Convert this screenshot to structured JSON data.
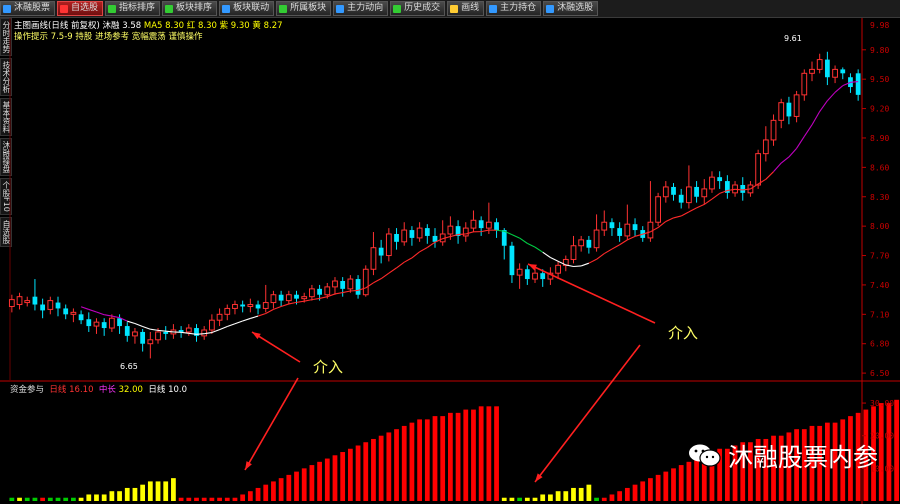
{
  "toolbar": {
    "buttons": [
      {
        "label": "沐融股票",
        "icon_color": "#39f"
      },
      {
        "label": "自选股",
        "icon_color": "#f33",
        "active": true
      },
      {
        "label": "指标排序",
        "icon_color": "#3c3"
      },
      {
        "label": "板块排序",
        "icon_color": "#3c3"
      },
      {
        "label": "板块联动",
        "icon_color": "#39f"
      },
      {
        "label": "所属板块",
        "icon_color": "#3c3"
      },
      {
        "label": "主力动向",
        "icon_color": "#39f"
      },
      {
        "label": "历史成交",
        "icon_color": "#3c3"
      },
      {
        "label": "画线",
        "icon_color": "#fc3"
      },
      {
        "label": "主力持仓",
        "icon_color": "#39f"
      },
      {
        "label": "沐融选股",
        "icon_color": "#39f"
      }
    ]
  },
  "sidebar": {
    "tabs": [
      "分时走势",
      "技术分析",
      "基本资料",
      "沐融操盘",
      "个股F10",
      "自选股"
    ]
  },
  "main_header": {
    "title": "主图画线(日线 前复权) 沐融 3.58",
    "vals": "MA5 8.30  红 8.30  紫 9.30  黄 8.27",
    "line2": "操作提示 7.5-9 持股 进场参考 宽幅震荡 谨慎操作"
  },
  "sub_header": {
    "name": "资金参与",
    "lbl1": "日线",
    "v1": "16.10",
    "lbl2": "中长",
    "v2": "32.00",
    "lbl3": "日线",
    "v3": "10.0"
  },
  "annotations": {
    "left": "介入",
    "right": "介入",
    "low_label": "6.65",
    "high_label": "9.61"
  },
  "watermark": "沐融股票内参",
  "colors": {
    "up": "#ff3232",
    "down": "#00e5ff",
    "ma_white": "#ffffff",
    "ma_red": "#ff2a2a",
    "ma_purple": "#c000c0",
    "ma_green": "#00cc44",
    "vol_red": "#ff0000",
    "vol_yellow": "#ffff00",
    "vol_green": "#00cc00",
    "arrow": "#ff2020",
    "axis": "#c00000"
  },
  "price_axis": {
    "ticks": [
      6.5,
      6.8,
      7.1,
      7.4,
      7.7,
      8.0,
      8.3,
      8.6,
      8.9,
      9.2,
      9.5,
      9.8
    ],
    "min": 6.45,
    "max": 9.9,
    "top_label": "9.98"
  },
  "vol_axis": {
    "ticks": [
      "10.00",
      "20.00",
      "30.00"
    ],
    "max": 34
  },
  "chart_data": {
    "type": "candlestick",
    "ohlc": [
      [
        7.18,
        7.25,
        7.12,
        7.3
      ],
      [
        7.2,
        7.28,
        7.15,
        7.32
      ],
      [
        7.22,
        7.24,
        7.18,
        7.28
      ],
      [
        7.28,
        7.2,
        7.14,
        7.46
      ],
      [
        7.2,
        7.14,
        7.06,
        7.26
      ],
      [
        7.15,
        7.24,
        7.1,
        7.28
      ],
      [
        7.22,
        7.16,
        7.08,
        7.28
      ],
      [
        7.16,
        7.1,
        7.05,
        7.2
      ],
      [
        7.1,
        7.12,
        7.02,
        7.16
      ],
      [
        7.1,
        7.04,
        7.0,
        7.14
      ],
      [
        7.05,
        6.98,
        6.92,
        7.12
      ],
      [
        6.98,
        7.02,
        6.9,
        7.06
      ],
      [
        7.02,
        6.96,
        6.88,
        7.06
      ],
      [
        6.96,
        7.06,
        6.92,
        7.1
      ],
      [
        7.06,
        6.98,
        6.9,
        7.1
      ],
      [
        6.98,
        6.88,
        6.82,
        7.02
      ],
      [
        6.88,
        6.92,
        6.8,
        6.96
      ],
      [
        6.92,
        6.8,
        6.72,
        6.95
      ],
      [
        6.8,
        6.84,
        6.65,
        6.92
      ],
      [
        6.84,
        6.92,
        6.8,
        6.96
      ],
      [
        6.92,
        6.9,
        6.84,
        6.98
      ],
      [
        6.9,
        6.94,
        6.85,
        7.0
      ],
      [
        6.94,
        6.92,
        6.86,
        6.98
      ],
      [
        6.92,
        6.96,
        6.88,
        7.0
      ],
      [
        6.96,
        6.88,
        6.82,
        7.0
      ],
      [
        6.88,
        6.94,
        6.84,
        6.98
      ],
      [
        6.94,
        7.04,
        6.9,
        7.1
      ],
      [
        7.04,
        7.1,
        6.98,
        7.16
      ],
      [
        7.1,
        7.16,
        7.04,
        7.2
      ],
      [
        7.16,
        7.2,
        7.1,
        7.24
      ],
      [
        7.2,
        7.18,
        7.12,
        7.24
      ],
      [
        7.18,
        7.2,
        7.12,
        7.26
      ],
      [
        7.2,
        7.16,
        7.1,
        7.24
      ],
      [
        7.16,
        7.22,
        7.12,
        7.4
      ],
      [
        7.22,
        7.3,
        7.16,
        7.34
      ],
      [
        7.3,
        7.24,
        7.18,
        7.34
      ],
      [
        7.24,
        7.3,
        7.2,
        7.34
      ],
      [
        7.3,
        7.26,
        7.2,
        7.34
      ],
      [
        7.26,
        7.28,
        7.22,
        7.32
      ],
      [
        7.28,
        7.36,
        7.24,
        7.4
      ],
      [
        7.36,
        7.3,
        7.24,
        7.4
      ],
      [
        7.3,
        7.38,
        7.26,
        7.42
      ],
      [
        7.38,
        7.44,
        7.3,
        7.48
      ],
      [
        7.44,
        7.36,
        7.28,
        7.48
      ],
      [
        7.36,
        7.46,
        7.32,
        7.5
      ],
      [
        7.46,
        7.3,
        7.26,
        7.5
      ],
      [
        7.3,
        7.56,
        7.28,
        7.6
      ],
      [
        7.56,
        7.78,
        7.5,
        7.94
      ],
      [
        7.78,
        7.7,
        7.62,
        7.86
      ],
      [
        7.7,
        7.92,
        7.64,
        7.98
      ],
      [
        7.92,
        7.84,
        7.76,
        7.98
      ],
      [
        7.84,
        7.96,
        7.8,
        8.04
      ],
      [
        7.96,
        7.88,
        7.8,
        8.0
      ],
      [
        7.88,
        7.98,
        7.84,
        8.04
      ],
      [
        7.98,
        7.9,
        7.82,
        8.02
      ],
      [
        7.9,
        7.84,
        7.78,
        7.98
      ],
      [
        7.84,
        7.92,
        7.8,
        8.06
      ],
      [
        7.92,
        8.0,
        7.86,
        8.1
      ],
      [
        8.0,
        7.9,
        7.82,
        8.06
      ],
      [
        7.9,
        7.98,
        7.84,
        8.04
      ],
      [
        7.98,
        8.06,
        7.94,
        8.16
      ],
      [
        8.06,
        7.98,
        7.9,
        8.1
      ],
      [
        7.98,
        8.04,
        7.92,
        8.24
      ],
      [
        8.04,
        7.96,
        7.88,
        8.08
      ],
      [
        7.96,
        7.8,
        7.66,
        7.98
      ],
      [
        7.8,
        7.5,
        7.42,
        7.84
      ],
      [
        7.5,
        7.56,
        7.36,
        7.62
      ],
      [
        7.56,
        7.46,
        7.4,
        7.6
      ],
      [
        7.46,
        7.52,
        7.42,
        7.6
      ],
      [
        7.52,
        7.46,
        7.38,
        7.56
      ],
      [
        7.46,
        7.52,
        7.4,
        7.58
      ],
      [
        7.52,
        7.6,
        7.46,
        7.64
      ],
      [
        7.6,
        7.66,
        7.54,
        7.7
      ],
      [
        7.66,
        7.8,
        7.62,
        7.9
      ],
      [
        7.8,
        7.86,
        7.74,
        7.9
      ],
      [
        7.86,
        7.78,
        7.72,
        7.9
      ],
      [
        7.78,
        7.96,
        7.74,
        8.12
      ],
      [
        7.96,
        8.04,
        7.9,
        8.16
      ],
      [
        8.04,
        7.98,
        7.9,
        8.08
      ],
      [
        7.98,
        7.9,
        7.84,
        8.04
      ],
      [
        7.9,
        8.02,
        7.86,
        8.22
      ],
      [
        8.02,
        7.96,
        7.9,
        8.08
      ],
      [
        7.96,
        7.88,
        7.84,
        8.0
      ],
      [
        7.88,
        8.04,
        7.84,
        8.46
      ],
      [
        8.04,
        8.3,
        8.0,
        8.34
      ],
      [
        8.3,
        8.4,
        8.24,
        8.46
      ],
      [
        8.4,
        8.32,
        8.26,
        8.44
      ],
      [
        8.32,
        8.24,
        8.18,
        8.38
      ],
      [
        8.24,
        8.4,
        8.18,
        8.62
      ],
      [
        8.4,
        8.3,
        8.24,
        8.46
      ],
      [
        8.3,
        8.38,
        8.22,
        8.48
      ],
      [
        8.38,
        8.5,
        8.34,
        8.56
      ],
      [
        8.5,
        8.46,
        8.38,
        8.56
      ],
      [
        8.46,
        8.34,
        8.28,
        8.52
      ],
      [
        8.34,
        8.42,
        8.3,
        8.46
      ],
      [
        8.42,
        8.34,
        8.26,
        8.5
      ],
      [
        8.34,
        8.42,
        8.3,
        8.46
      ],
      [
        8.42,
        8.74,
        8.38,
        8.78
      ],
      [
        8.74,
        8.88,
        8.66,
        9.02
      ],
      [
        8.88,
        9.08,
        8.82,
        9.14
      ],
      [
        9.08,
        9.26,
        9.0,
        9.3
      ],
      [
        9.26,
        9.12,
        9.04,
        9.32
      ],
      [
        9.12,
        9.34,
        9.06,
        9.38
      ],
      [
        9.34,
        9.56,
        9.28,
        9.6
      ],
      [
        9.56,
        9.6,
        9.48,
        9.68
      ],
      [
        9.6,
        9.7,
        9.56,
        9.76
      ],
      [
        9.7,
        9.52,
        9.44,
        9.78
      ],
      [
        9.52,
        9.6,
        9.46,
        9.64
      ],
      [
        9.6,
        9.56,
        9.5,
        9.62
      ],
      [
        9.52,
        9.42,
        9.36,
        9.56
      ],
      [
        9.56,
        9.34,
        9.28,
        9.6
      ]
    ],
    "volume": [
      1,
      1,
      1,
      1,
      1,
      1,
      1,
      1,
      1,
      1,
      2,
      2,
      2,
      3,
      3,
      4,
      4,
      5,
      6,
      6,
      6,
      7,
      1,
      1,
      1,
      1,
      1,
      1,
      1,
      1,
      2,
      3,
      4,
      5,
      6,
      7,
      8,
      9,
      10,
      11,
      12,
      13,
      14,
      15,
      16,
      17,
      18,
      19,
      20,
      21,
      22,
      23,
      24,
      25,
      25,
      26,
      26,
      27,
      27,
      28,
      28,
      29,
      29,
      29,
      1,
      1,
      1,
      1,
      1,
      2,
      2,
      3,
      3,
      4,
      4,
      5,
      1,
      1,
      2,
      3,
      4,
      5,
      6,
      7,
      8,
      9,
      10,
      11,
      12,
      13,
      14,
      15,
      16,
      16,
      17,
      18,
      18,
      19,
      19,
      20,
      20,
      21,
      22,
      22,
      23,
      23,
      24,
      24,
      25,
      26,
      27,
      28,
      29,
      30,
      30,
      31,
      32
    ],
    "volume_colors": [
      "g",
      "y",
      "g",
      "g",
      "r",
      "g",
      "g",
      "g",
      "g",
      "y",
      "y",
      "y",
      "y",
      "y",
      "y",
      "y",
      "y",
      "y",
      "y",
      "y",
      "y",
      "y",
      "r",
      "r",
      "r",
      "r",
      "r",
      "r",
      "r",
      "r",
      "r",
      "r",
      "r",
      "r",
      "r",
      "r",
      "r",
      "r",
      "r",
      "r",
      "r",
      "r",
      "r",
      "r",
      "r",
      "r",
      "r",
      "r",
      "r",
      "r",
      "r",
      "r",
      "r",
      "r",
      "r",
      "r",
      "r",
      "r",
      "r",
      "r",
      "r",
      "r",
      "r",
      "r",
      "y",
      "y",
      "g",
      "y",
      "y",
      "y",
      "y",
      "y",
      "y",
      "y",
      "y",
      "y",
      "g",
      "r",
      "r",
      "r",
      "r",
      "r",
      "r",
      "r",
      "r",
      "r",
      "r",
      "r",
      "r",
      "r",
      "r",
      "r",
      "r",
      "r",
      "r",
      "r",
      "r",
      "r",
      "r",
      "r",
      "r",
      "r",
      "r",
      "r",
      "r",
      "r",
      "r",
      "r",
      "r",
      "r",
      "r",
      "r",
      "r",
      "r",
      "r",
      "r",
      "r"
    ]
  }
}
